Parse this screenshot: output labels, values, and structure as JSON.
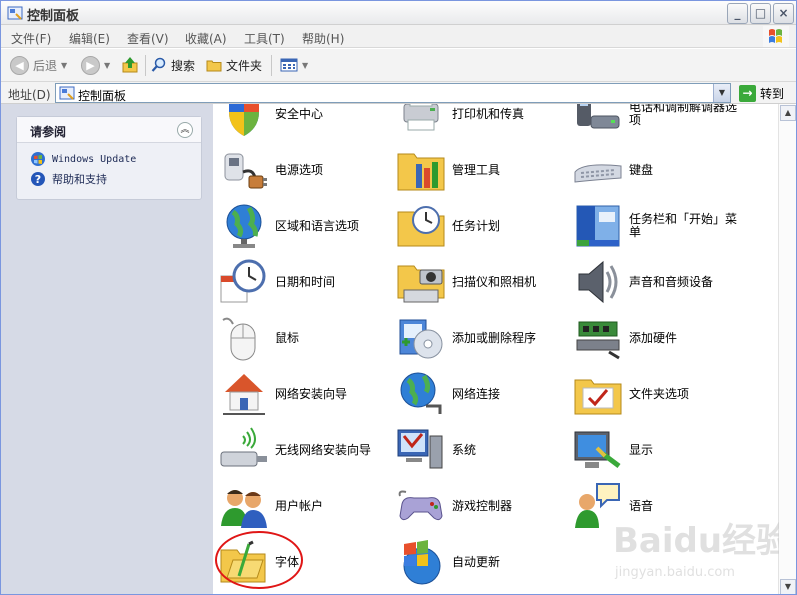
{
  "window": {
    "title": "控制面板"
  },
  "window_buttons": {
    "minimize": "_",
    "maximize": "□",
    "close": "×"
  },
  "menu": [
    {
      "label": "文件(F)"
    },
    {
      "label": "编辑(E)"
    },
    {
      "label": "查看(V)"
    },
    {
      "label": "收藏(A)"
    },
    {
      "label": "工具(T)"
    },
    {
      "label": "帮助(H)"
    }
  ],
  "toolbar": {
    "back_label": "后退",
    "search_label": "搜索",
    "folders_label": "文件夹"
  },
  "address": {
    "label": "地址(D)",
    "value": "控制面板",
    "go_label": "转到"
  },
  "see_also": {
    "title": "请参阅",
    "links": [
      {
        "label": "Windows Update",
        "icon": "windows-update-icon"
      },
      {
        "label": "帮助和支持",
        "icon": "help-icon"
      }
    ]
  },
  "items": [
    {
      "label": "安全中心",
      "icon": "security-center-icon"
    },
    {
      "label": "打印机和传真",
      "icon": "printer-icon"
    },
    {
      "label": "电话和调制解调器选项",
      "icon": "phone-modem-icon"
    },
    {
      "label": "电源选项",
      "icon": "power-options-icon"
    },
    {
      "label": "管理工具",
      "icon": "admin-tools-icon"
    },
    {
      "label": "键盘",
      "icon": "keyboard-icon"
    },
    {
      "label": "区域和语言选项",
      "icon": "globe-icon"
    },
    {
      "label": "任务计划",
      "icon": "scheduled-tasks-icon"
    },
    {
      "label": "任务栏和「开始」菜单",
      "icon": "taskbar-icon"
    },
    {
      "label": "日期和时间",
      "icon": "clock-icon"
    },
    {
      "label": "扫描仪和照相机",
      "icon": "scanner-camera-icon"
    },
    {
      "label": "声音和音频设备",
      "icon": "speaker-icon"
    },
    {
      "label": "鼠标",
      "icon": "mouse-icon"
    },
    {
      "label": "添加或删除程序",
      "icon": "add-remove-programs-icon"
    },
    {
      "label": "添加硬件",
      "icon": "add-hardware-icon"
    },
    {
      "label": "网络安装向导",
      "icon": "network-setup-icon"
    },
    {
      "label": "网络连接",
      "icon": "network-connections-icon"
    },
    {
      "label": "文件夹选项",
      "icon": "folder-options-icon"
    },
    {
      "label": "无线网络安装向导",
      "icon": "wireless-network-icon"
    },
    {
      "label": "系统",
      "icon": "system-icon"
    },
    {
      "label": "显示",
      "icon": "display-icon"
    },
    {
      "label": "用户帐户",
      "icon": "user-accounts-icon"
    },
    {
      "label": "游戏控制器",
      "icon": "game-controller-icon"
    },
    {
      "label": "语音",
      "icon": "speech-icon"
    },
    {
      "label": "字体",
      "icon": "fonts-folder-icon"
    },
    {
      "label": "自动更新",
      "icon": "automatic-updates-icon"
    }
  ],
  "watermark": {
    "brand": "Baidu经验",
    "url": "jingyan.baidu.com"
  },
  "colors": {
    "task_pane_bg": "#d6dae6",
    "annotation_circle": "#e01616",
    "link_text": "#1d2a55"
  }
}
